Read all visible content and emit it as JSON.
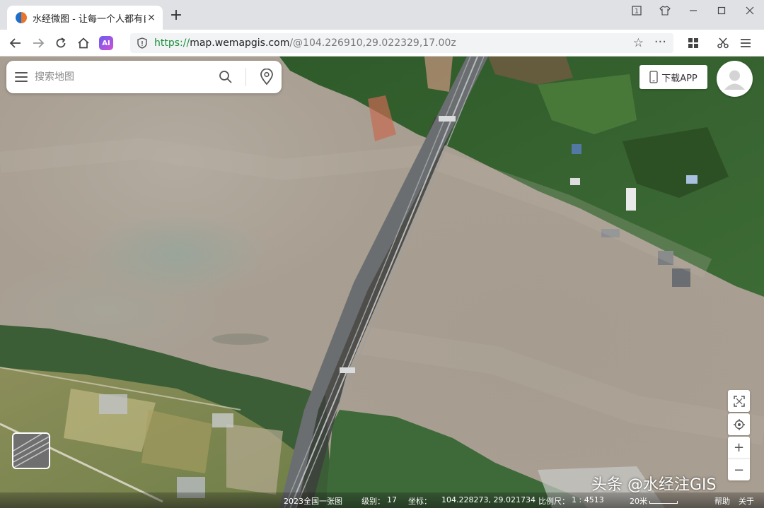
{
  "browser": {
    "tab_title": "水经微图 - 让每一个人都有自",
    "tab_close": "×",
    "new_tab": "+",
    "url_protocol": "https://",
    "url_host": "map.wemapgis.com",
    "url_path": "/@104.226910,29.022329,17.00z",
    "ai_label": "AI"
  },
  "map": {
    "search_placeholder": "搜索地图",
    "download_label": "下载APP",
    "zoom_in": "+",
    "zoom_out": "−"
  },
  "status": {
    "source": "2023全国一张图",
    "level_label": "级别：",
    "level_value": "17",
    "coord_label": "坐标：",
    "coord_value": "104.228273, 29.021734",
    "scale_label": "比例尺：",
    "scale_value": "1 : 4513",
    "scale_bar": "20米",
    "help": "帮助",
    "close": "关于"
  },
  "watermark": "头条 @水经注GIS",
  "colors": {
    "river": "#a89e91",
    "vegetation": "#3f6b34",
    "bridge_shadow": "#3e403d",
    "url_protocol": "#1a8f3a"
  }
}
